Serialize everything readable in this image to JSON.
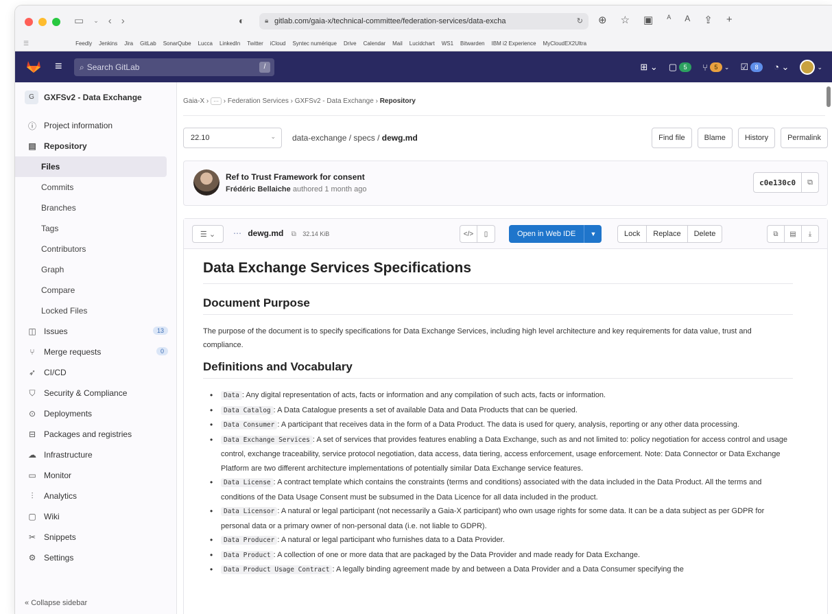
{
  "browser": {
    "url": "gitlab.com/gaia-x/technical-committee/federation-services/data-excha",
    "bookmarks": [
      "Feedly",
      "Jenkins",
      "Jira",
      "GitLab",
      "SonarQube",
      "Lucca",
      "LinkedIn",
      "Twitter",
      "iCloud",
      "Syntec numérique",
      "Drive",
      "Calendar",
      "Mail",
      "Lucidchart",
      "WS1",
      "Bitwarden",
      "IBM i2 Experience",
      "MyCloudEX2Ultra"
    ]
  },
  "header": {
    "search_placeholder": "Search GitLab",
    "slash": "/",
    "issues_count": "5",
    "mr_count": "5",
    "todo_count": "8"
  },
  "sidebar": {
    "project_initial": "G",
    "project_name": "GXFSv2 - Data Exchange",
    "items": [
      {
        "label": "Project information",
        "icon": "info-icon"
      },
      {
        "label": "Repository",
        "icon": "book-icon"
      },
      {
        "label": "Files"
      },
      {
        "label": "Commits"
      },
      {
        "label": "Branches"
      },
      {
        "label": "Tags"
      },
      {
        "label": "Contributors"
      },
      {
        "label": "Graph"
      },
      {
        "label": "Compare"
      },
      {
        "label": "Locked Files"
      },
      {
        "label": "Issues",
        "icon": "issues-icon",
        "badge": "13"
      },
      {
        "label": "Merge requests",
        "icon": "merge-icon",
        "badge": "0"
      },
      {
        "label": "CI/CD",
        "icon": "rocket-icon"
      },
      {
        "label": "Security & Compliance",
        "icon": "shield-icon"
      },
      {
        "label": "Deployments",
        "icon": "deploy-icon"
      },
      {
        "label": "Packages and registries",
        "icon": "package-icon"
      },
      {
        "label": "Infrastructure",
        "icon": "cloud-icon"
      },
      {
        "label": "Monitor",
        "icon": "monitor-icon"
      },
      {
        "label": "Analytics",
        "icon": "chart-icon"
      },
      {
        "label": "Wiki",
        "icon": "wiki-icon"
      },
      {
        "label": "Snippets",
        "icon": "scissors-icon"
      },
      {
        "label": "Settings",
        "icon": "gear-icon"
      }
    ],
    "collapse": "Collapse sidebar"
  },
  "breadcrumb": {
    "root": "Gaia-X",
    "ellipsis": "···",
    "parent": "Federation Services",
    "project": "GXFSv2 - Data Exchange",
    "current": "Repository"
  },
  "file_nav": {
    "branch": "22.10",
    "path_repo": "data-exchange",
    "path_dir": "specs",
    "path_file": "dewg.md",
    "find_file": "Find file",
    "blame": "Blame",
    "history": "History",
    "permalink": "Permalink"
  },
  "commit": {
    "title": "Ref to Trust Framework for consent",
    "author": "Frédéric Bellaiche",
    "meta": "authored 1 month ago",
    "sha": "c0e130c0"
  },
  "file": {
    "name": "dewg.md",
    "size": "32.14 KiB",
    "open_ide": "Open in Web IDE",
    "lock": "Lock",
    "replace": "Replace",
    "delete": "Delete"
  },
  "content": {
    "h1": "Data Exchange Services Specifications",
    "h2_purpose": "Document Purpose",
    "purpose": "The purpose of the document is to specify specifications for Data Exchange Services, including high level architecture and key requirements for data value, trust and compliance.",
    "h2_defs": "Definitions and Vocabulary",
    "definitions": [
      {
        "term": "Data",
        "text": ": Any digital representation of acts, facts or information and any compilation of such acts, facts or information."
      },
      {
        "term": "Data Catalog",
        "text": ": A Data Catalogue presents a set of available Data and Data Products that can be queried."
      },
      {
        "term": "Data Consumer",
        "text": ": A participant that receives data in the form of a Data Product. The data is used for query, analysis, reporting or any other data processing."
      },
      {
        "term": "Data Exchange Services",
        "text": ": A set of services that provides features enabling a Data Exchange, such as and not limited to: policy negotiation for access control and usage control, exchange traceability, service protocol negotiation, data access, data tiering, access enforcement, usage enforcement. Note: Data Connector or Data Exchange Platform are two different architecture implementations of potentially similar Data Exchange service features."
      },
      {
        "term": "Data License",
        "text": ": A contract template which contains the constraints (terms and conditions) associated with the data included in the Data Product. All the terms and conditions of the Data Usage Consent must be subsumed in the Data Licence for all data included in the product."
      },
      {
        "term": "Data Licensor",
        "text": ": A natural or legal participant (not necessarily a Gaia-X participant) who own usage rights for some data. It can be a data subject as per GDPR for personal data or a primary owner of non-personal data (i.e. not liable to GDPR)."
      },
      {
        "term": "Data Producer",
        "text": ": A natural or legal participant who furnishes data to a Data Provider."
      },
      {
        "term": "Data Product",
        "text": ": A collection of one or more data that are packaged by the Data Provider and made ready for Data Exchange."
      },
      {
        "term": "Data Product Usage Contract",
        "text": ": A legally binding agreement made by and between a Data Provider and a Data Consumer specifying the"
      }
    ]
  },
  "colors": {
    "header_bg": "#292961",
    "primary_button": "#1f75cb",
    "sidebar_bg": "#fbfafd"
  }
}
